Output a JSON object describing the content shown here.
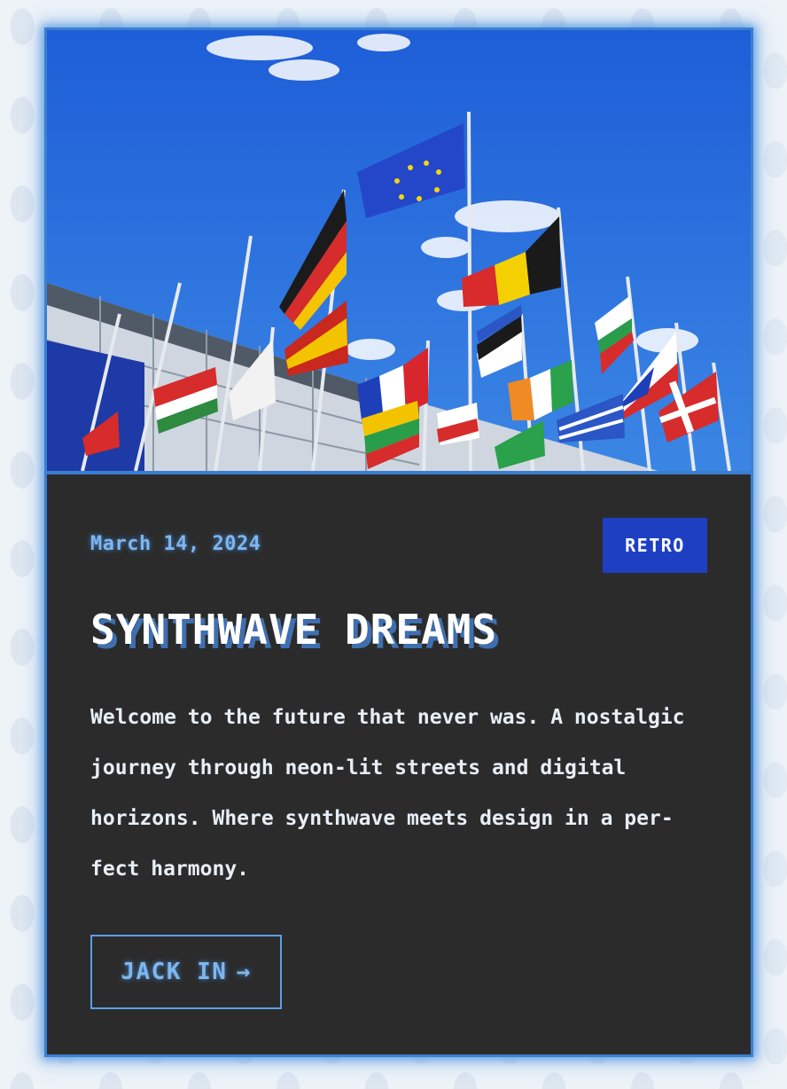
{
  "card": {
    "image_alt": "Flags of European countries flying in front of a building under a blue sky",
    "date": "March 14, 2024",
    "tag": "RETRO",
    "title": "SYNTHWAVE DREAMS",
    "excerpt": "Welcome to the future that never was. A nostalgic journey through neon-lit streets and digital horizons. Where synthwave meets design in a per-fect harmony.",
    "cta_label": "JACK IN",
    "cta_arrow": "→",
    "cta_icon": "arrow-right-icon"
  },
  "colors": {
    "accent": "#4a90e2",
    "card_background": "#2b2b2b",
    "badge_background": "#1f3fc2",
    "title_shadow": "#3f6fb0"
  }
}
